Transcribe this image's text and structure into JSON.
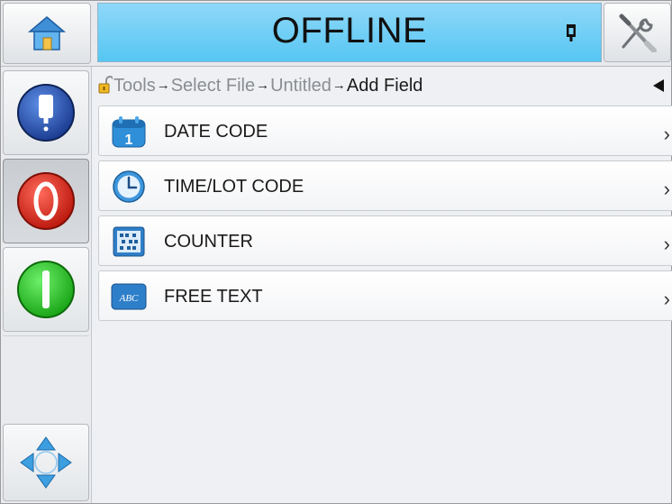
{
  "status": {
    "text": "OFFLINE",
    "color": "#56c6f3"
  },
  "topbar": {
    "home_icon": "home-icon",
    "alert_icon": "printhead-alert-icon",
    "tools_icon": "tools-icon"
  },
  "sidebar": {
    "buttons": [
      {
        "name": "ink-system-button",
        "icon": "ink-bottle-icon",
        "state": "normal"
      },
      {
        "name": "stop-button",
        "icon": "stop-icon",
        "state": "pressed"
      },
      {
        "name": "start-button",
        "icon": "start-icon",
        "state": "normal"
      },
      {
        "name": "navigation-button",
        "icon": "navigation-arrows-icon",
        "state": "normal"
      }
    ]
  },
  "breadcrumb": {
    "items": [
      "Tools",
      "Select File",
      "Untitled"
    ],
    "current": "Add Field",
    "separator": "→"
  },
  "fields": [
    {
      "label": "DATE CODE",
      "icon": "calendar-icon"
    },
    {
      "label": "TIME/LOT CODE",
      "icon": "clock-icon"
    },
    {
      "label": "COUNTER",
      "icon": "abacus-icon"
    },
    {
      "label": "FREE TEXT",
      "icon": "abc-text-icon"
    }
  ],
  "chevron": "›"
}
